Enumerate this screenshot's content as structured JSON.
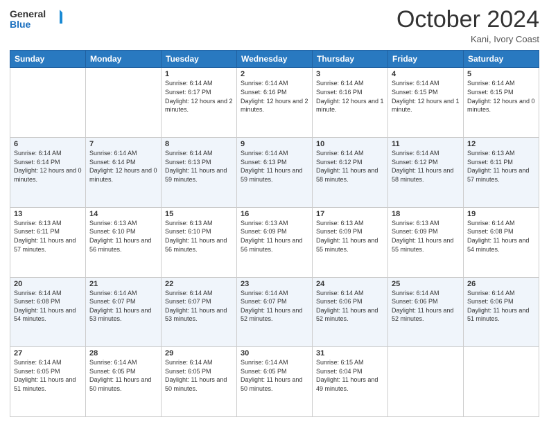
{
  "logo": {
    "line1": "General",
    "line2": "Blue"
  },
  "title": "October 2024",
  "subtitle": "Kani, Ivory Coast",
  "days_of_week": [
    "Sunday",
    "Monday",
    "Tuesday",
    "Wednesday",
    "Thursday",
    "Friday",
    "Saturday"
  ],
  "weeks": [
    [
      {
        "day": "",
        "sunrise": "",
        "sunset": "",
        "daylight": ""
      },
      {
        "day": "",
        "sunrise": "",
        "sunset": "",
        "daylight": ""
      },
      {
        "day": "1",
        "sunrise": "Sunrise: 6:14 AM",
        "sunset": "Sunset: 6:17 PM",
        "daylight": "Daylight: 12 hours and 2 minutes."
      },
      {
        "day": "2",
        "sunrise": "Sunrise: 6:14 AM",
        "sunset": "Sunset: 6:16 PM",
        "daylight": "Daylight: 12 hours and 2 minutes."
      },
      {
        "day": "3",
        "sunrise": "Sunrise: 6:14 AM",
        "sunset": "Sunset: 6:16 PM",
        "daylight": "Daylight: 12 hours and 1 minute."
      },
      {
        "day": "4",
        "sunrise": "Sunrise: 6:14 AM",
        "sunset": "Sunset: 6:15 PM",
        "daylight": "Daylight: 12 hours and 1 minute."
      },
      {
        "day": "5",
        "sunrise": "Sunrise: 6:14 AM",
        "sunset": "Sunset: 6:15 PM",
        "daylight": "Daylight: 12 hours and 0 minutes."
      }
    ],
    [
      {
        "day": "6",
        "sunrise": "Sunrise: 6:14 AM",
        "sunset": "Sunset: 6:14 PM",
        "daylight": "Daylight: 12 hours and 0 minutes."
      },
      {
        "day": "7",
        "sunrise": "Sunrise: 6:14 AM",
        "sunset": "Sunset: 6:14 PM",
        "daylight": "Daylight: 12 hours and 0 minutes."
      },
      {
        "day": "8",
        "sunrise": "Sunrise: 6:14 AM",
        "sunset": "Sunset: 6:13 PM",
        "daylight": "Daylight: 11 hours and 59 minutes."
      },
      {
        "day": "9",
        "sunrise": "Sunrise: 6:14 AM",
        "sunset": "Sunset: 6:13 PM",
        "daylight": "Daylight: 11 hours and 59 minutes."
      },
      {
        "day": "10",
        "sunrise": "Sunrise: 6:14 AM",
        "sunset": "Sunset: 6:12 PM",
        "daylight": "Daylight: 11 hours and 58 minutes."
      },
      {
        "day": "11",
        "sunrise": "Sunrise: 6:14 AM",
        "sunset": "Sunset: 6:12 PM",
        "daylight": "Daylight: 11 hours and 58 minutes."
      },
      {
        "day": "12",
        "sunrise": "Sunrise: 6:13 AM",
        "sunset": "Sunset: 6:11 PM",
        "daylight": "Daylight: 11 hours and 57 minutes."
      }
    ],
    [
      {
        "day": "13",
        "sunrise": "Sunrise: 6:13 AM",
        "sunset": "Sunset: 6:11 PM",
        "daylight": "Daylight: 11 hours and 57 minutes."
      },
      {
        "day": "14",
        "sunrise": "Sunrise: 6:13 AM",
        "sunset": "Sunset: 6:10 PM",
        "daylight": "Daylight: 11 hours and 56 minutes."
      },
      {
        "day": "15",
        "sunrise": "Sunrise: 6:13 AM",
        "sunset": "Sunset: 6:10 PM",
        "daylight": "Daylight: 11 hours and 56 minutes."
      },
      {
        "day": "16",
        "sunrise": "Sunrise: 6:13 AM",
        "sunset": "Sunset: 6:09 PM",
        "daylight": "Daylight: 11 hours and 56 minutes."
      },
      {
        "day": "17",
        "sunrise": "Sunrise: 6:13 AM",
        "sunset": "Sunset: 6:09 PM",
        "daylight": "Daylight: 11 hours and 55 minutes."
      },
      {
        "day": "18",
        "sunrise": "Sunrise: 6:13 AM",
        "sunset": "Sunset: 6:09 PM",
        "daylight": "Daylight: 11 hours and 55 minutes."
      },
      {
        "day": "19",
        "sunrise": "Sunrise: 6:14 AM",
        "sunset": "Sunset: 6:08 PM",
        "daylight": "Daylight: 11 hours and 54 minutes."
      }
    ],
    [
      {
        "day": "20",
        "sunrise": "Sunrise: 6:14 AM",
        "sunset": "Sunset: 6:08 PM",
        "daylight": "Daylight: 11 hours and 54 minutes."
      },
      {
        "day": "21",
        "sunrise": "Sunrise: 6:14 AM",
        "sunset": "Sunset: 6:07 PM",
        "daylight": "Daylight: 11 hours and 53 minutes."
      },
      {
        "day": "22",
        "sunrise": "Sunrise: 6:14 AM",
        "sunset": "Sunset: 6:07 PM",
        "daylight": "Daylight: 11 hours and 53 minutes."
      },
      {
        "day": "23",
        "sunrise": "Sunrise: 6:14 AM",
        "sunset": "Sunset: 6:07 PM",
        "daylight": "Daylight: 11 hours and 52 minutes."
      },
      {
        "day": "24",
        "sunrise": "Sunrise: 6:14 AM",
        "sunset": "Sunset: 6:06 PM",
        "daylight": "Daylight: 11 hours and 52 minutes."
      },
      {
        "day": "25",
        "sunrise": "Sunrise: 6:14 AM",
        "sunset": "Sunset: 6:06 PM",
        "daylight": "Daylight: 11 hours and 52 minutes."
      },
      {
        "day": "26",
        "sunrise": "Sunrise: 6:14 AM",
        "sunset": "Sunset: 6:06 PM",
        "daylight": "Daylight: 11 hours and 51 minutes."
      }
    ],
    [
      {
        "day": "27",
        "sunrise": "Sunrise: 6:14 AM",
        "sunset": "Sunset: 6:05 PM",
        "daylight": "Daylight: 11 hours and 51 minutes."
      },
      {
        "day": "28",
        "sunrise": "Sunrise: 6:14 AM",
        "sunset": "Sunset: 6:05 PM",
        "daylight": "Daylight: 11 hours and 50 minutes."
      },
      {
        "day": "29",
        "sunrise": "Sunrise: 6:14 AM",
        "sunset": "Sunset: 6:05 PM",
        "daylight": "Daylight: 11 hours and 50 minutes."
      },
      {
        "day": "30",
        "sunrise": "Sunrise: 6:14 AM",
        "sunset": "Sunset: 6:05 PM",
        "daylight": "Daylight: 11 hours and 50 minutes."
      },
      {
        "day": "31",
        "sunrise": "Sunrise: 6:15 AM",
        "sunset": "Sunset: 6:04 PM",
        "daylight": "Daylight: 11 hours and 49 minutes."
      },
      {
        "day": "",
        "sunrise": "",
        "sunset": "",
        "daylight": ""
      },
      {
        "day": "",
        "sunrise": "",
        "sunset": "",
        "daylight": ""
      }
    ]
  ]
}
